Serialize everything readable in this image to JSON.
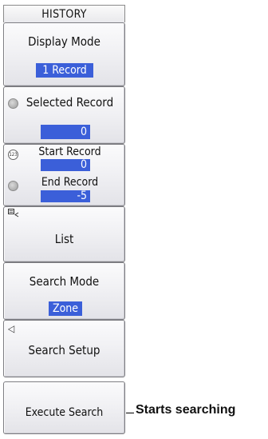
{
  "menu": {
    "header": "HISTORY",
    "display_mode": {
      "title": "Display Mode",
      "value": "1 Record"
    },
    "selected_record": {
      "title": "Selected Record",
      "value": "0"
    },
    "record_range": {
      "start_title": "Start Record",
      "start_value": "0",
      "end_title": "End Record",
      "end_value": "-5",
      "start_knob_label": "123"
    },
    "list": {
      "title": "List"
    },
    "search_mode": {
      "title": "Search Mode",
      "value": "Zone"
    },
    "search_setup": {
      "title": "Search Setup",
      "arrow": "◁"
    },
    "execute_search": {
      "title": "Execute Search"
    }
  },
  "annotation": {
    "text": "Starts searching"
  }
}
